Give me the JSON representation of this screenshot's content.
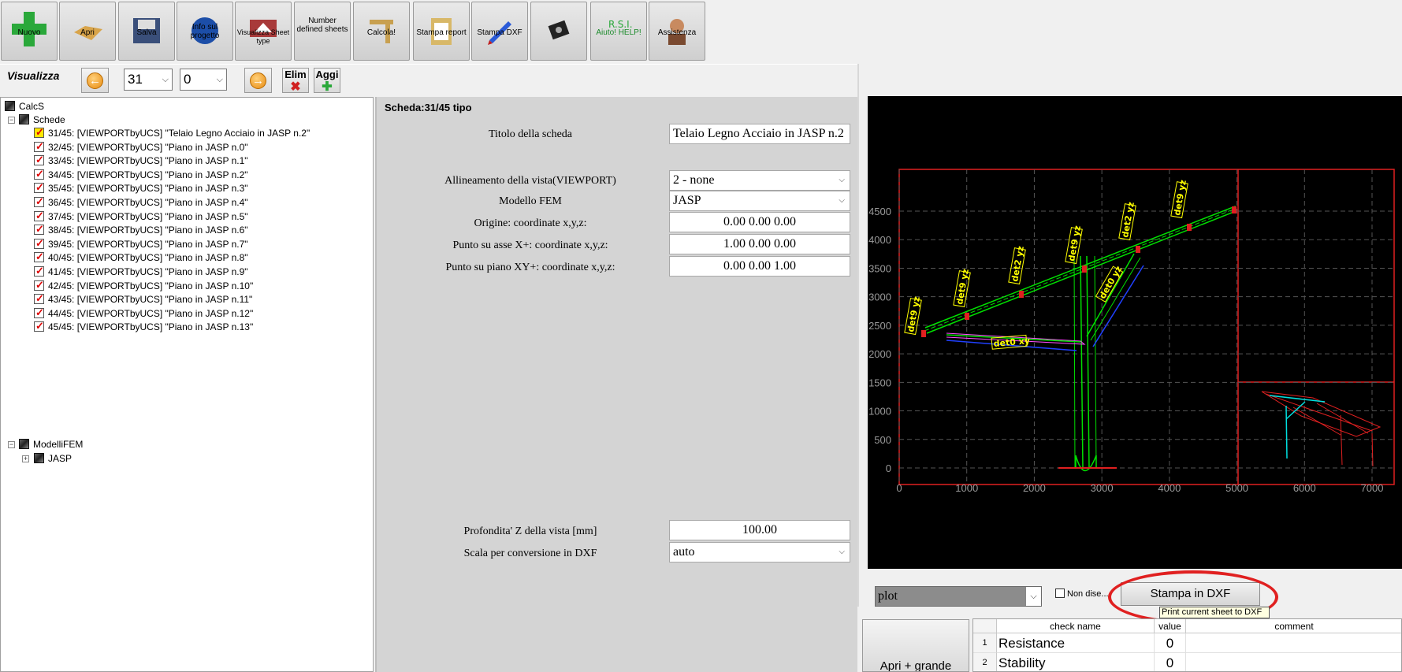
{
  "toolbar": {
    "buttons": [
      {
        "label": "Nuovo"
      },
      {
        "label": "Apri"
      },
      {
        "label": "Salva"
      },
      {
        "label": "Info sul progetto"
      },
      {
        "label": "Visualizza Sheet type"
      },
      {
        "label": "Number defined sheets"
      },
      {
        "label": "Calcola!"
      },
      {
        "label": "Stampa report"
      },
      {
        "label": "Stampa DXF"
      },
      {
        "label": ""
      },
      {
        "label": "Aiuto! HELP!"
      },
      {
        "label": "Assistenza"
      }
    ]
  },
  "nav": {
    "visualizza_label": "Visualizza",
    "sheet_number": "31",
    "sub_number": "0",
    "elim_label": "Elim",
    "aggi_label": "Aggi"
  },
  "tree": {
    "root": "CalcS",
    "schede_label": "Schede",
    "sheets": [
      "31/45: [VIEWPORTbyUCS] \"Telaio Legno Acciaio in JASP n.2\"",
      "32/45: [VIEWPORTbyUCS] \"Piano in JASP n.0\"",
      "33/45: [VIEWPORTbyUCS] \"Piano in JASP n.1\"",
      "34/45: [VIEWPORTbyUCS] \"Piano in JASP n.2\"",
      "35/45: [VIEWPORTbyUCS] \"Piano in JASP n.3\"",
      "36/45: [VIEWPORTbyUCS] \"Piano in JASP n.4\"",
      "37/45: [VIEWPORTbyUCS] \"Piano in JASP n.5\"",
      "38/45: [VIEWPORTbyUCS] \"Piano in JASP n.6\"",
      "39/45: [VIEWPORTbyUCS] \"Piano in JASP n.7\"",
      "40/45: [VIEWPORTbyUCS] \"Piano in JASP n.8\"",
      "41/45: [VIEWPORTbyUCS] \"Piano in JASP n.9\"",
      "42/45: [VIEWPORTbyUCS] \"Piano in JASP n.10\"",
      "43/45: [VIEWPORTbyUCS] \"Piano in JASP n.11\"",
      "44/45: [VIEWPORTbyUCS] \"Piano in JASP n.12\"",
      "45/45: [VIEWPORTbyUCS] \"Piano in JASP n.13\""
    ],
    "modelli_label": "ModelliFEM",
    "jasp_label": "JASP"
  },
  "form": {
    "title": "Scheda:31/45 tipo",
    "titolo_label": "Titolo della scheda",
    "titolo_value": "Telaio Legno Acciaio in JASP n.2",
    "allineamento_label": "Allineamento della vista(VIEWPORT)",
    "allineamento_value": "2 - none",
    "modello_label": "Modello FEM",
    "modello_value": "JASP",
    "origine_label": "Origine: coordinate x,y,z:",
    "origine_value": "0.00 0.00 0.00",
    "asse_label": "Punto su asse X+: coordinate x,y,z:",
    "asse_value": "1.00 0.00 0.00",
    "piano_label": "Punto su piano XY+: coordinate x,y,z:",
    "piano_value": "0.00 0.00 1.00",
    "profondita_label": "Profondita' Z della vista [mm]",
    "profondita_value": "100.00",
    "scala_label": "Scala per conversione in DXF",
    "scala_value": "auto"
  },
  "plot": {
    "y_ticks": [
      "4500",
      "4000",
      "3500",
      "3000",
      "2500",
      "2000",
      "1500",
      "1000",
      "500",
      "0"
    ],
    "x_ticks": [
      "0",
      "1000",
      "2000",
      "3000",
      "4000",
      "5000",
      "6000",
      "7000"
    ],
    "labels": [
      "det9 yz",
      "det9 yz",
      "det2 yz",
      "det9 yz",
      "det2 yz",
      "det9 yz",
      "det0 yz",
      "det0 xy"
    ],
    "colors": {
      "beam": "#00e000",
      "axis": "#e02020",
      "label": "#ffff00",
      "secondary": "#2040ff",
      "inset": "#00e0e0"
    }
  },
  "bottom": {
    "plot_combo": "plot",
    "non_dise_label": "Non dise...",
    "stampa_label": "Stampa in DXF",
    "tooltip": "Print current sheet to DXF",
    "apri_label": "Apri + grande"
  },
  "checks": {
    "headers": [
      "check name",
      "value",
      "comment"
    ],
    "rows": [
      {
        "idx": "1",
        "name": "Resistance",
        "value": "0",
        "comment": ""
      },
      {
        "idx": "2",
        "name": "Stability",
        "value": "0",
        "comment": ""
      }
    ]
  }
}
